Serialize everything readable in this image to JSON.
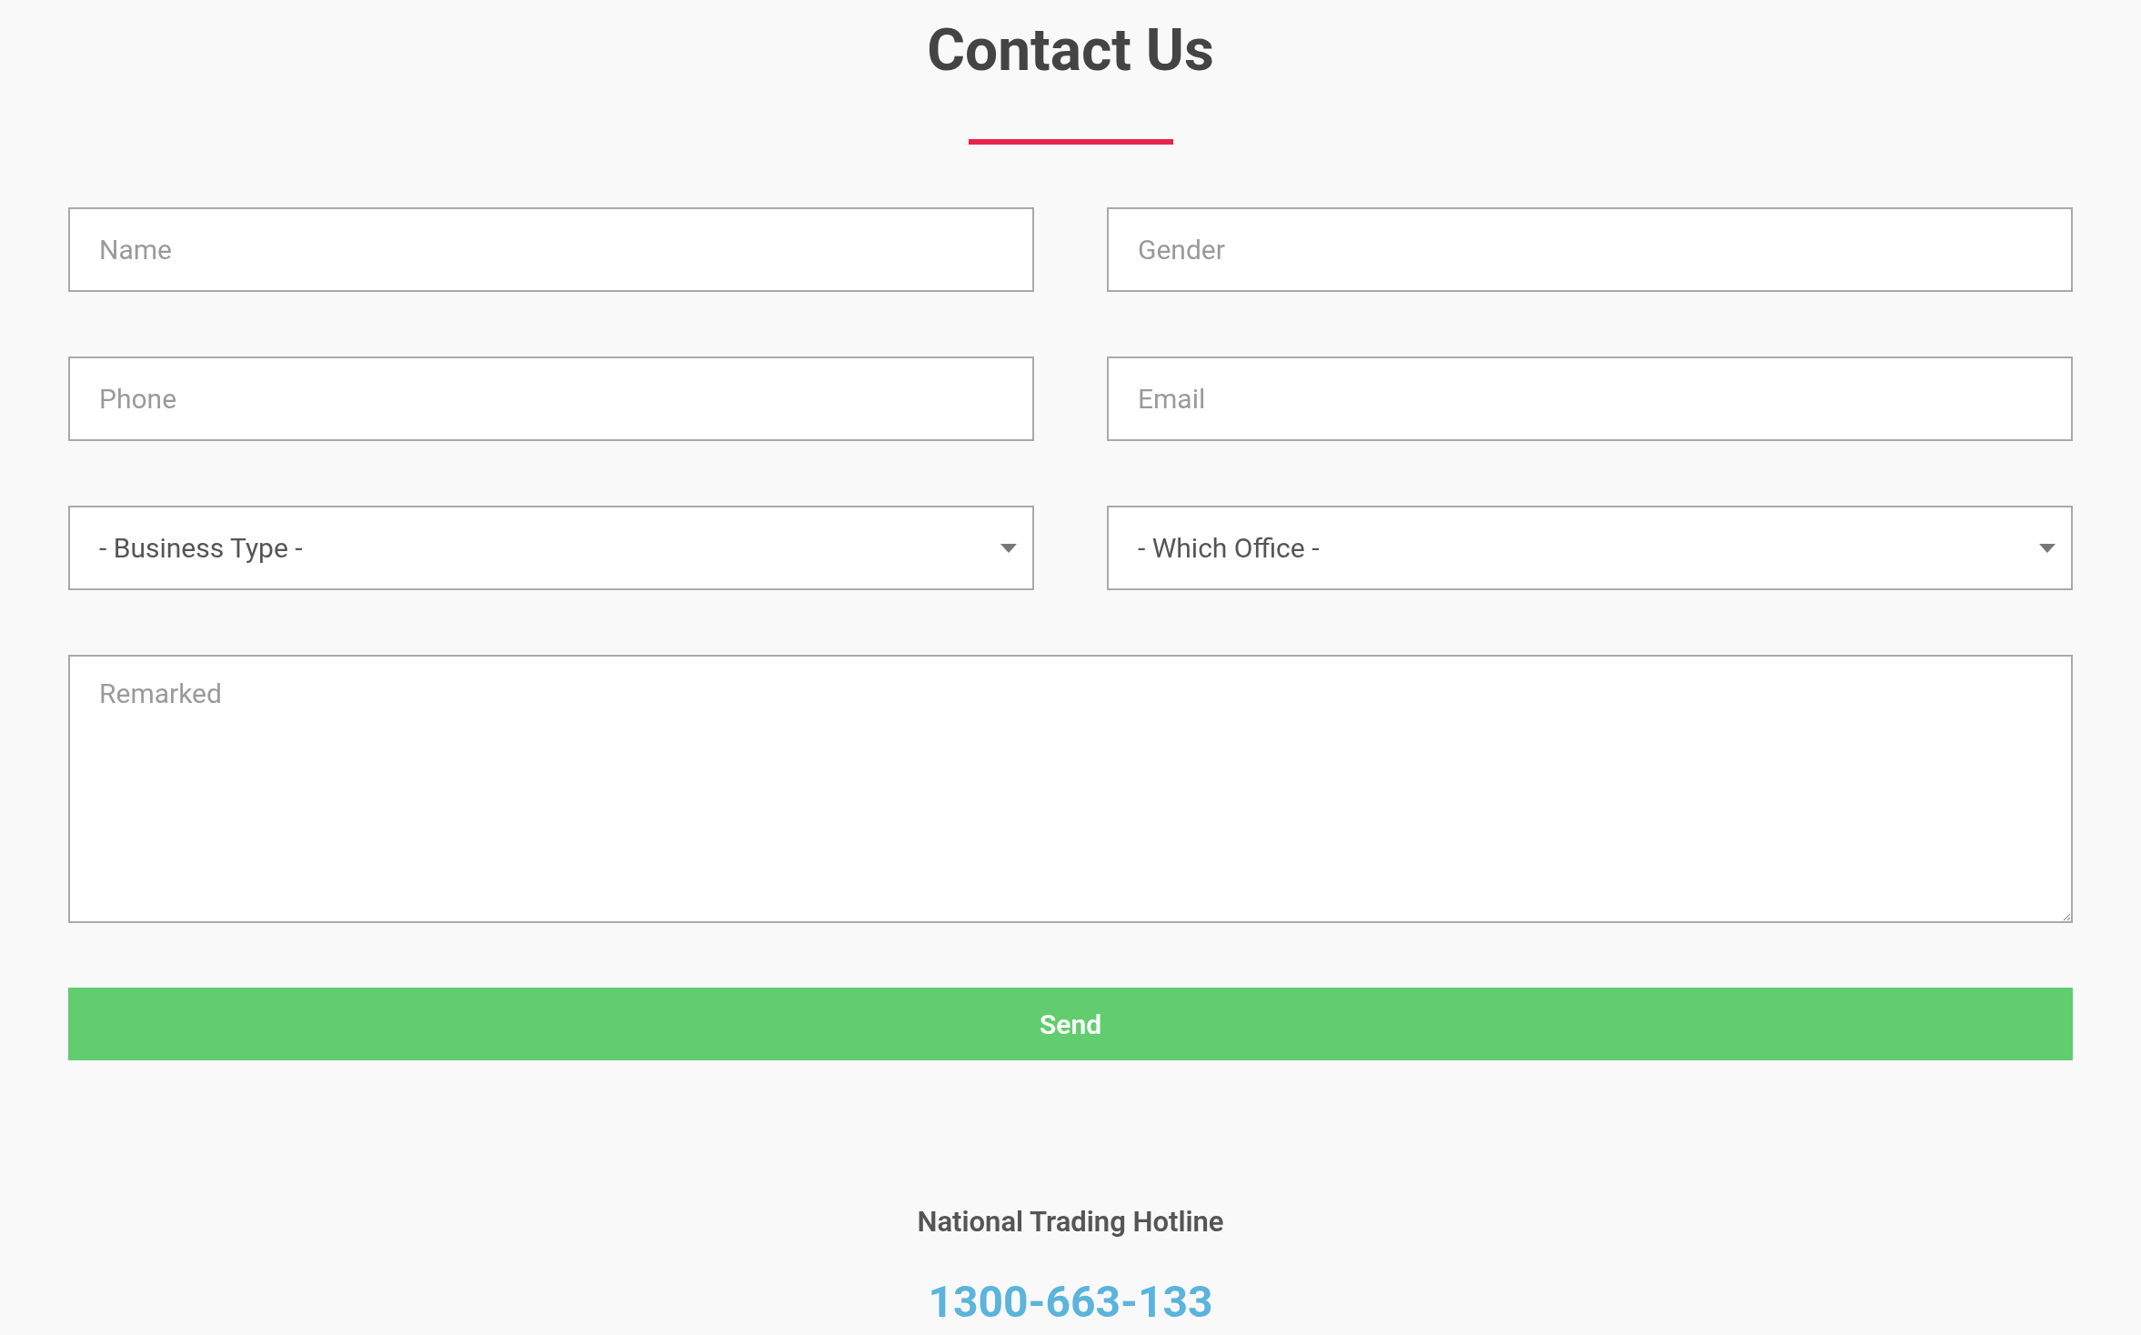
{
  "title": "Contact Us",
  "fields": [
    {
      "kind": "input",
      "placeholder": "Name"
    },
    {
      "kind": "input",
      "placeholder": "Gender"
    },
    {
      "kind": "input",
      "placeholder": "Phone"
    },
    {
      "kind": "input",
      "placeholder": "Email"
    },
    {
      "kind": "select",
      "value": "- Business Type -"
    },
    {
      "kind": "select",
      "value": "- Which Office -"
    },
    {
      "kind": "textarea",
      "placeholder": "Remarked"
    }
  ],
  "send_button": "Send",
  "hotline": {
    "label": "National Trading Hotline",
    "number": "1300-663-133"
  }
}
